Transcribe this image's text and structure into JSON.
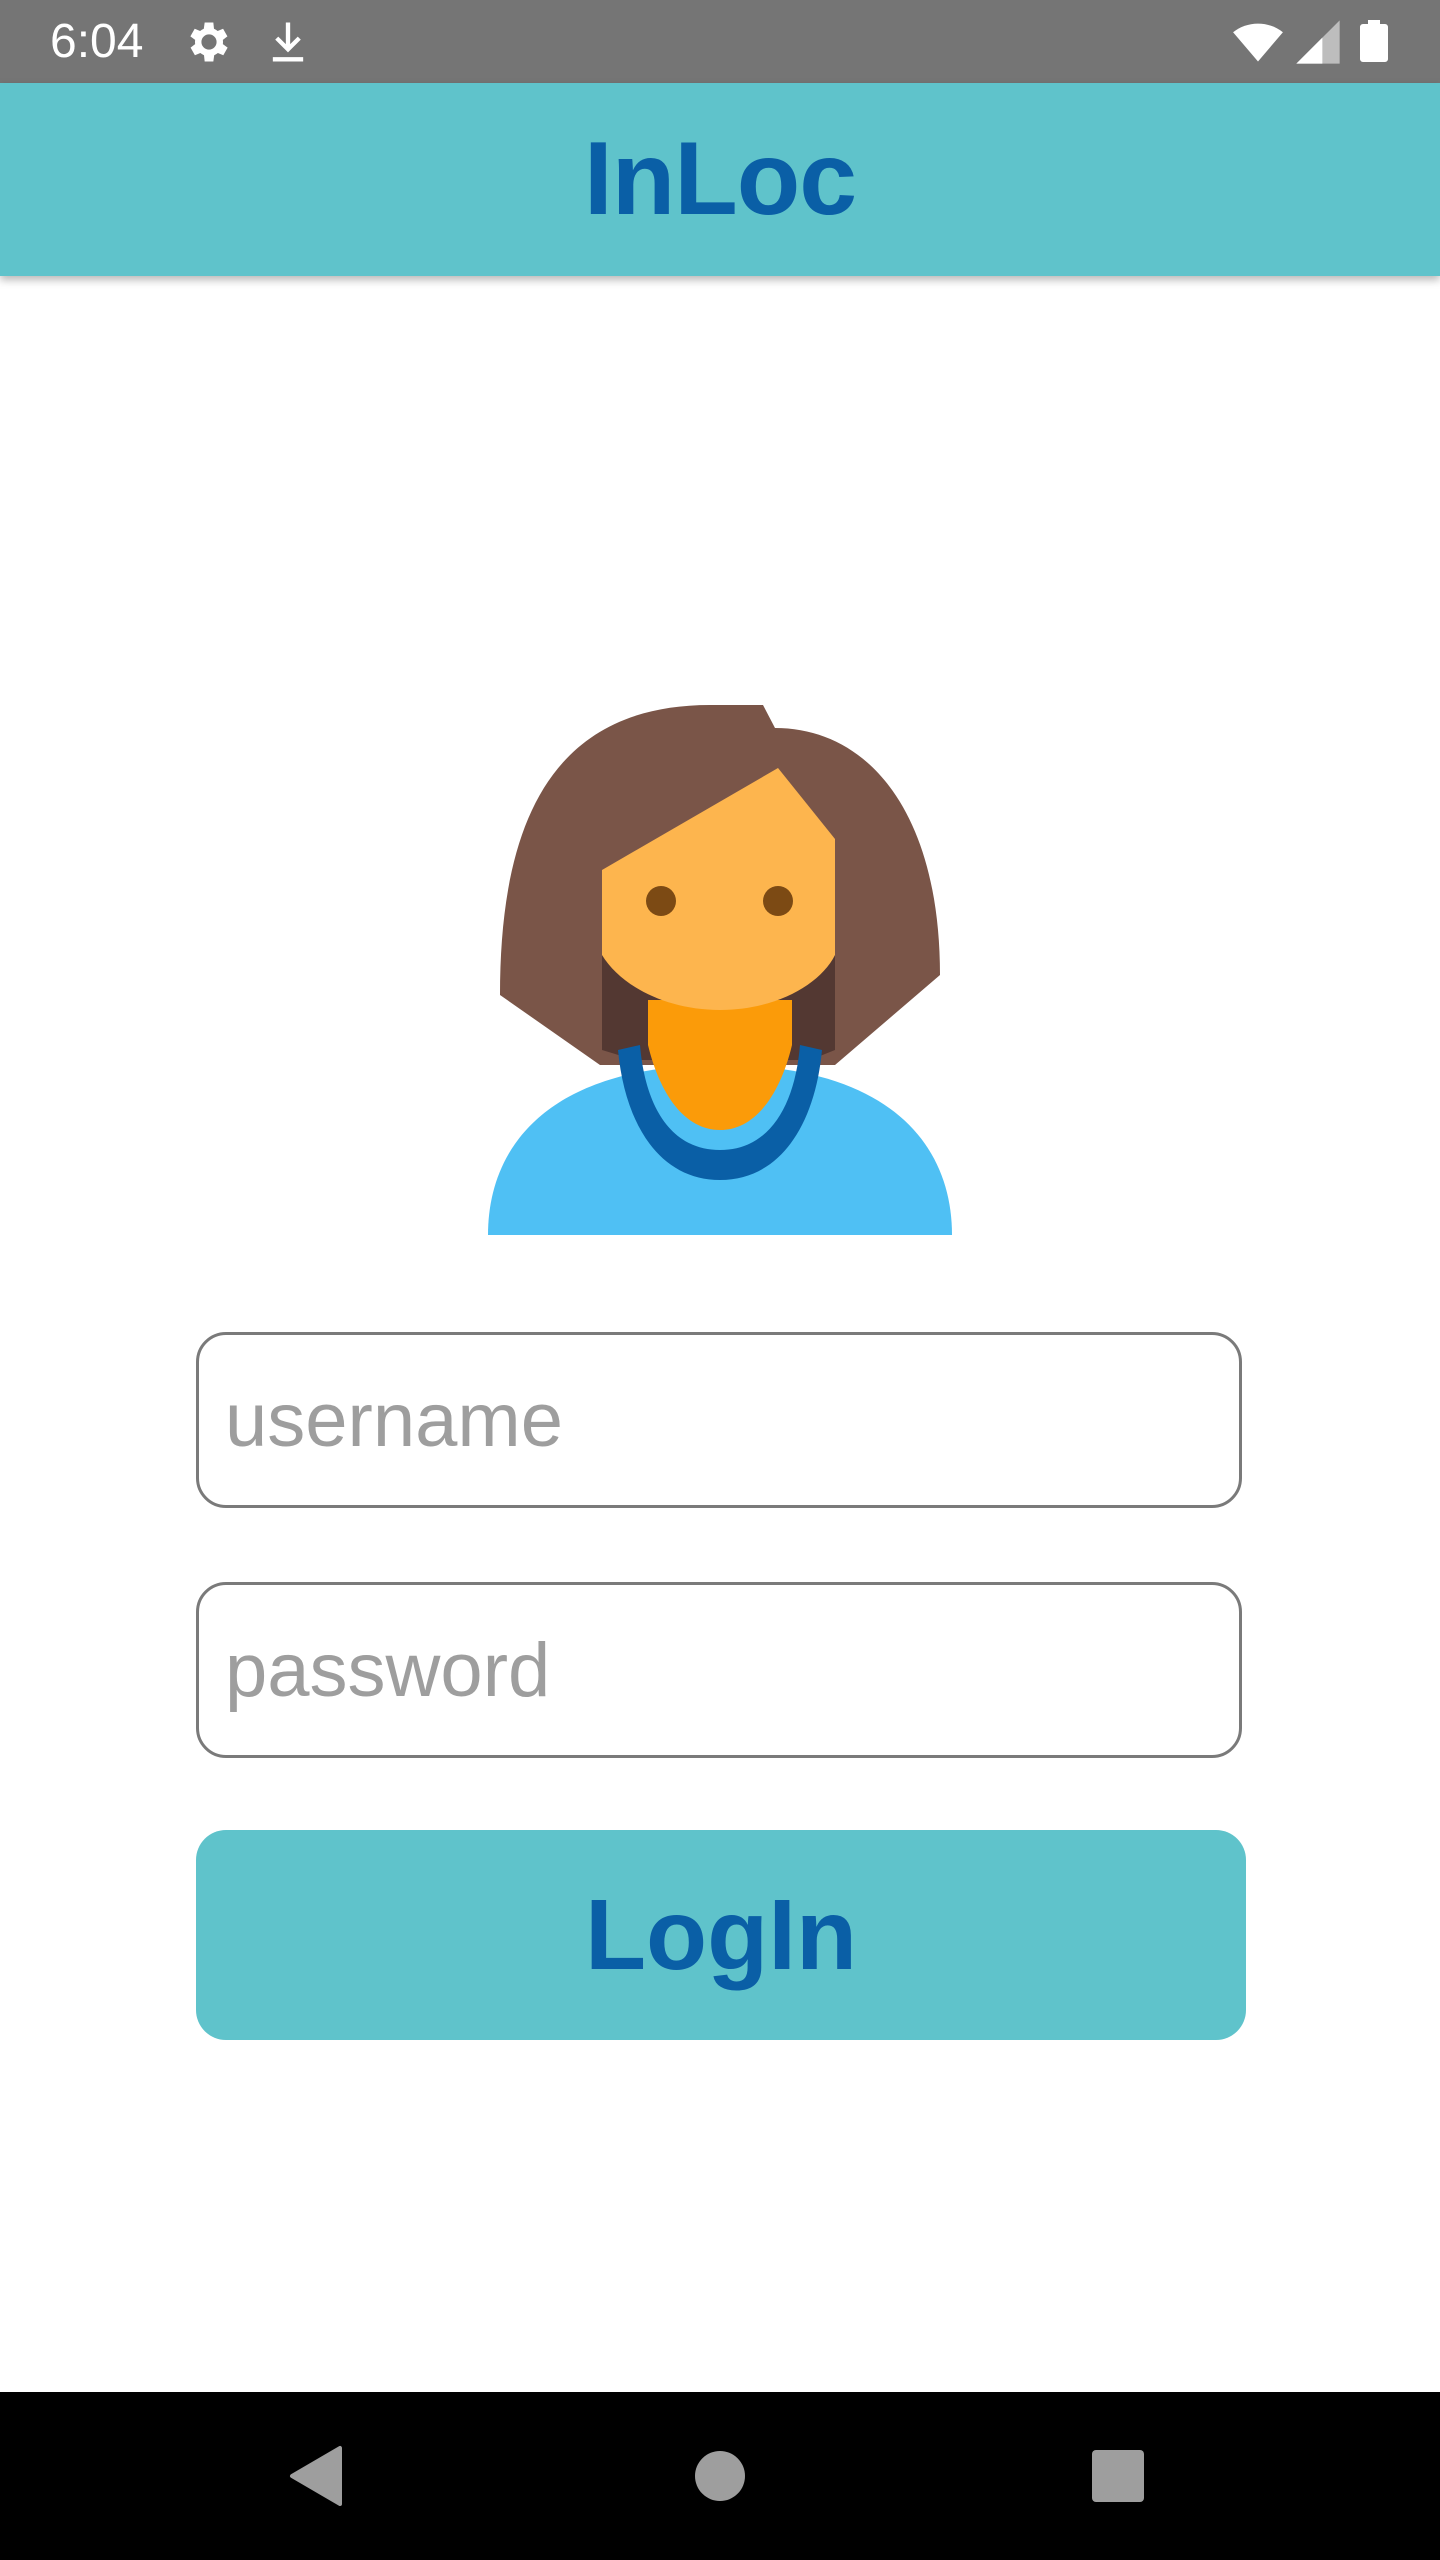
{
  "status_bar": {
    "time": "6:04",
    "icons": [
      "gear-icon",
      "download-icon",
      "wifi-icon",
      "cell-signal-icon",
      "battery-icon"
    ]
  },
  "app_bar": {
    "title": "InLoc"
  },
  "avatar": {
    "icon": "woman-avatar-icon"
  },
  "login_form": {
    "username_placeholder": "username",
    "username_value": "",
    "password_placeholder": "password",
    "password_value": "",
    "login_label": "LogIn"
  },
  "nav_bar": {
    "icons": [
      "back-icon",
      "home-icon",
      "recents-icon"
    ]
  },
  "colors": {
    "status_bar": "#757575",
    "app_bar": "#5fc3cb",
    "title_text": "#0a5fa6",
    "button": "#5fc3cb",
    "nav_bar": "#000000"
  }
}
